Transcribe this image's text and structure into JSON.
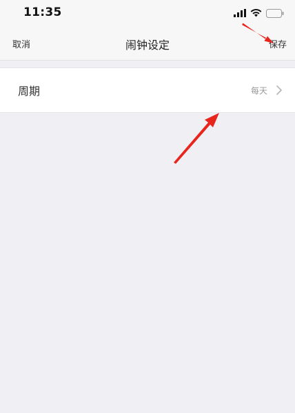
{
  "status_bar": {
    "time": "11:35",
    "signal_icon": "signal-bars-icon",
    "wifi_icon": "wifi-icon",
    "battery_icon": "battery-icon"
  },
  "nav": {
    "cancel_label": "取消",
    "title": "闹钟设定",
    "save_label": "保存"
  },
  "settings": {
    "rows": [
      {
        "label": "周期",
        "value": "每天",
        "icon": "chevron-right-icon"
      }
    ]
  },
  "annotation": {
    "color": "#e8251d"
  }
}
